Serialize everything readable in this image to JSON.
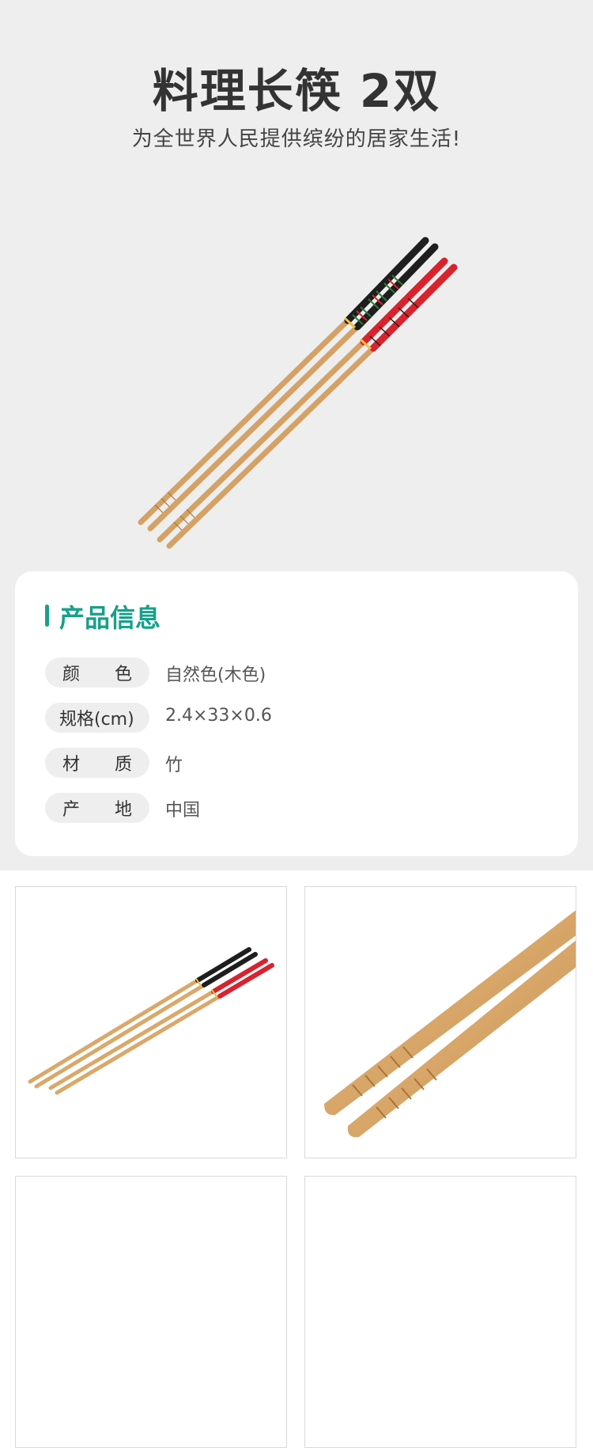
{
  "header": {
    "title": "料理长筷 2双",
    "subtitle": "为全世界人民提供缤纷的居家生活!"
  },
  "info_card": {
    "heading": "产品信息",
    "rows": [
      {
        "label_chars": [
          "颜",
          "色"
        ],
        "value": "自然色(木色)"
      },
      {
        "label": "规格(cm)",
        "value": "2.4×33×0.6"
      },
      {
        "label_chars": [
          "材",
          "质"
        ],
        "value": "竹"
      },
      {
        "label_chars": [
          "产",
          "地"
        ],
        "value": "中国"
      }
    ]
  },
  "colors": {
    "accent": "#17a08a",
    "hero_background": "#eeeeee",
    "bamboo": "#d9a86a",
    "black_handle": "#1e1e1e",
    "red_handle": "#d8232e"
  }
}
